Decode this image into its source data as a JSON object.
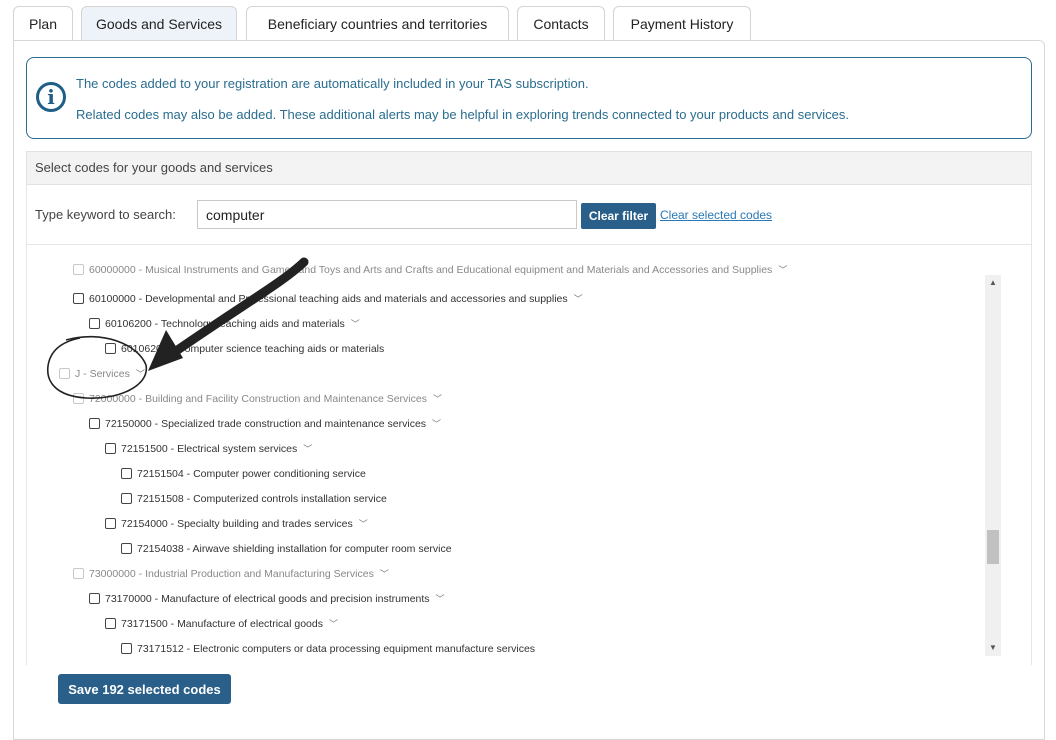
{
  "tabs": [
    {
      "label": "Plan"
    },
    {
      "label": "Goods and Services"
    },
    {
      "label": "Beneficiary countries and territories"
    },
    {
      "label": "Contacts"
    },
    {
      "label": "Payment History"
    }
  ],
  "info": {
    "line1": "The codes added to your registration are automatically included in your TAS subscription.",
    "line2": "Related codes may also be added. These additional alerts may be helpful in exploring trends connected to your products and services."
  },
  "section": {
    "title": "Select codes for your goods and services"
  },
  "search": {
    "label": "Type keyword to search:",
    "value": "computer",
    "clear_filter": "Clear filter",
    "clear_selected": "Clear selected codes"
  },
  "tree": [
    {
      "code": "60000000",
      "desc": "Musical Instruments and Games and Toys and Arts and Crafts and Educational equipment and Materials and Accessories and Supplies",
      "disabled": true,
      "partial": true
    },
    {
      "code": "60100000",
      "desc": "Developmental and Professional teaching aids and materials and accessories and supplies"
    },
    {
      "code": "60106200",
      "desc": "Technology teaching aids and materials"
    },
    {
      "code": "60106204",
      "desc": "Computer science teaching aids or materials"
    },
    {
      "code": "J",
      "desc": "Services",
      "disabled": true
    },
    {
      "code": "72000000",
      "desc": "Building and Facility Construction and Maintenance Services",
      "disabled": true
    },
    {
      "code": "72150000",
      "desc": "Specialized trade construction and maintenance services"
    },
    {
      "code": "72151500",
      "desc": "Electrical system services"
    },
    {
      "code": "72151504",
      "desc": "Computer power conditioning service"
    },
    {
      "code": "72151508",
      "desc": "Computerized controls installation service"
    },
    {
      "code": "72154000",
      "desc": "Specialty building and trades services"
    },
    {
      "code": "72154038",
      "desc": "Airwave shielding installation for computer room service"
    },
    {
      "code": "73000000",
      "desc": "Industrial Production and Manufacturing Services",
      "disabled": true
    },
    {
      "code": "73170000",
      "desc": "Manufacture of electrical goods and precision instruments"
    },
    {
      "code": "73171500",
      "desc": "Manufacture of electrical goods"
    },
    {
      "code": "73171512",
      "desc": "Electronic computers or data processing equipment manufacture services"
    }
  ],
  "save": {
    "label": "Save 192 selected codes"
  },
  "colors": {
    "accent": "#2a5f8a",
    "info_border": "#2a6d8f",
    "link": "#2a78b5"
  }
}
